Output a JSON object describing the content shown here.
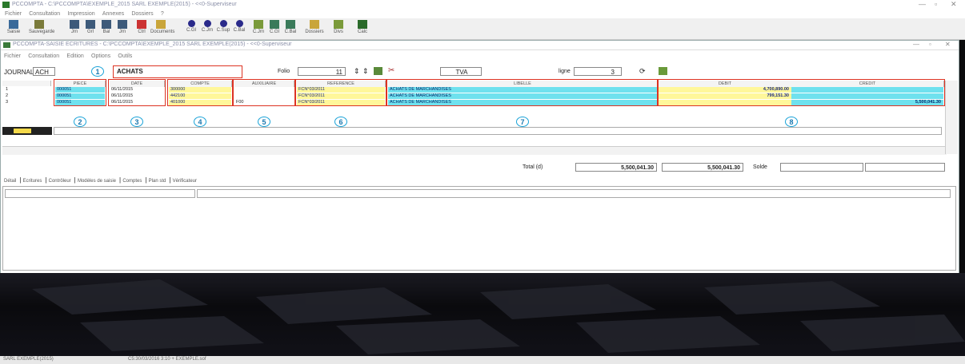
{
  "app": {
    "title": "PCCOMPTA - C:\\PCCOMPTA\\EXEMPLE_2015 SARL EXEMPLE(2015) - <<0-Superviseur",
    "menu": [
      "Fichier",
      "Consultation",
      "Impression",
      "Annexes",
      "Dossiers",
      "?"
    ],
    "toolbar": [
      {
        "label": "Saisie",
        "icon": "pencil-chart-icon"
      },
      {
        "label": "Sauvegarde",
        "icon": "tools-icon"
      },
      {
        "label": "Jrn",
        "icon": "grid-icon"
      },
      {
        "label": "Grl",
        "icon": "grid-icon"
      },
      {
        "label": "Bal",
        "icon": "grid-icon"
      },
      {
        "label": "Jrn",
        "icon": "grid-icon"
      },
      {
        "label": "Ctrl",
        "icon": "check-icon"
      },
      {
        "label": "Documents",
        "icon": "folder-icon"
      },
      {
        "label": "C.Gl",
        "icon": "dot-icon"
      },
      {
        "label": "C.Jrn",
        "icon": "dot-icon"
      },
      {
        "label": "C.Sup",
        "icon": "dot-icon"
      },
      {
        "label": "C.Bal",
        "icon": "dot-icon"
      },
      {
        "label": "C.Jrn",
        "icon": "arrow-icon"
      },
      {
        "label": "C.Gl",
        "icon": "person-icon"
      },
      {
        "label": "C.Bal",
        "icon": "person-icon"
      },
      {
        "label": "Dossiers",
        "icon": "folder-icon"
      },
      {
        "label": "Divs",
        "icon": "arrow-icon"
      },
      {
        "label": "Calc",
        "icon": "calculator-icon"
      }
    ]
  },
  "window": {
    "title": "PCCOMPTA-SAISIE ECRITURES - C:\\PCCOMPTA\\EXEMPLE_2015 SARL EXEMPLE(2015) - <<0-Superviseur",
    "menu": [
      "Fichier",
      "Consultation",
      "Edition",
      "Options",
      "Outils"
    ],
    "journal_label": "JOURNAL",
    "journal_code": "ACH",
    "journal_name": "ACHATS",
    "folio_label": "Folio",
    "folio_value": "11",
    "tva_label": "TVA",
    "ligne_label": "ligne",
    "ligne_value": "3"
  },
  "callouts": [
    "1",
    "2",
    "3",
    "4",
    "5",
    "6",
    "7",
    "8"
  ],
  "table": {
    "columns": [
      "PIECE",
      "DATE",
      "COMPTE",
      "AUXILIAIRE",
      "REFERENCE",
      "LIBELLE",
      "DEBIT",
      "CREDIT"
    ],
    "rows": [
      {
        "n": "1",
        "piece": "000051",
        "date": "06/11/2015",
        "compte": "300000",
        "aux": "",
        "ref": "FCN°03/2011",
        "lib": "ACHATS DE MARCHANDISES",
        "debit": "4,700,890.00",
        "credit": ""
      },
      {
        "n": "2",
        "piece": "000051",
        "date": "06/11/2015",
        "compte": "442100",
        "aux": "",
        "ref": "FCN°03/2011",
        "lib": "ACHATS DE MARCHANDISES",
        "debit": "799,151.30",
        "credit": ""
      },
      {
        "n": "3",
        "piece": "000051",
        "date": "06/11/2015",
        "compte": "401000",
        "aux": "F00",
        "ref": "FCN°03/2011",
        "lib": "ACHATS DE MARCHANDISES",
        "debit": "",
        "credit": "5,500,041.30"
      }
    ]
  },
  "totals": {
    "label": "Total (d)",
    "debit": "5,500,041.30",
    "credit": "5,500,041.30",
    "solde_label": "Solde"
  },
  "tabs": [
    "Détail",
    "Ecritures",
    "Contrôleur",
    "Modèles de saisie",
    "Comptes",
    "Plan std",
    "Vérificateur"
  ],
  "status": {
    "left": "SARL EXEMPLE(2015)",
    "right": "C5:30/03/2016 3:10 +  EXEMPLE.sof"
  },
  "colors": {
    "cyan": "#6fe1ee",
    "yellow": "#fff79a",
    "callout_red": "#d32f2f",
    "callout_blue": "#1ba3d8"
  }
}
